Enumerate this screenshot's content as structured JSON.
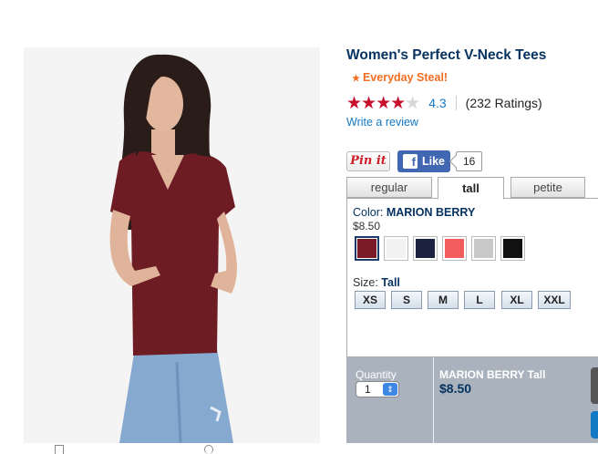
{
  "product": {
    "title": "Women's Perfect V-Neck Tees",
    "badge_icon": "star-icon",
    "badge": "Everyday Steal!",
    "rating_value": 4.3,
    "rating_text": "4.3",
    "rating_count": "(232 Ratings)",
    "review_link": "Write a review"
  },
  "social": {
    "pin_label": "Pin it",
    "like_label": "Like",
    "like_count": "16"
  },
  "fit_tabs": [
    {
      "label": "regular",
      "selected": false
    },
    {
      "label": "tall",
      "selected": true
    },
    {
      "label": "petite",
      "selected": false
    }
  ],
  "color": {
    "label": "Color:",
    "selected": "MARION BERRY",
    "price": "$8.50",
    "swatches": [
      {
        "color": "#7a1b27",
        "selected": true
      },
      {
        "color": "#f2f2f2",
        "selected": false
      },
      {
        "color": "#1c2340",
        "selected": false
      },
      {
        "color": "#f25c5c",
        "selected": false
      },
      {
        "color": "#c9c9c9",
        "selected": false
      },
      {
        "color": "#111111",
        "selected": false
      }
    ]
  },
  "size": {
    "label": "Size:",
    "selected": "Tall",
    "options": [
      "XS",
      "S",
      "M",
      "L",
      "XL",
      "XXL"
    ]
  },
  "purchase": {
    "quantity_label": "Quantity",
    "quantity_value": "1",
    "selection_name": "MARION BERRY Tall",
    "selection_price": "$8.50"
  },
  "colors": {
    "title": "#073361",
    "accent": "#f26d21",
    "star": "#c8102e",
    "link": "#1479c5"
  }
}
